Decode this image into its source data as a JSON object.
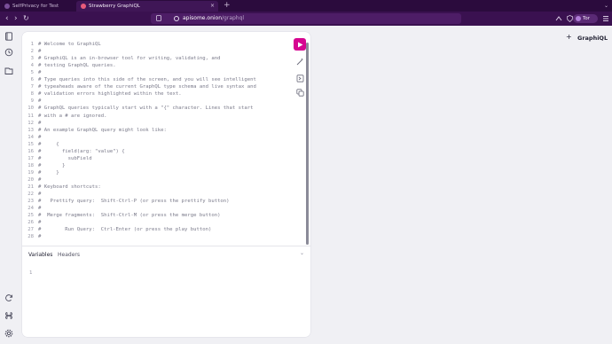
{
  "browser": {
    "tabs": [
      {
        "label": "SelfPrivacy for Test",
        "active": false
      },
      {
        "label": "Strawberry GraphiQL",
        "active": true
      }
    ],
    "close_glyph": "×",
    "new_tab_glyph": "+",
    "tab_list_glyph": "⌄",
    "nav": {
      "back": "‹",
      "forward": "›",
      "reload": "↻"
    },
    "url": {
      "host": "apisome.onion",
      "path": "/graphql"
    },
    "tor_label": "Tor"
  },
  "editor": {
    "lines": [
      {
        "n": "1",
        "t": "# Welcome to GraphiQL"
      },
      {
        "n": "2",
        "t": "#"
      },
      {
        "n": "3",
        "t": "# GraphiQL is an in-browser tool for writing, validating, and"
      },
      {
        "n": "4",
        "t": "# testing GraphQL queries."
      },
      {
        "n": "5",
        "t": "#"
      },
      {
        "n": "6",
        "t": "# Type queries into this side of the screen, and you will see intelligent"
      },
      {
        "n": "7",
        "t": "# typeaheads aware of the current GraphQL type schema and live syntax and"
      },
      {
        "n": "8",
        "t": "# validation errors highlighted within the text."
      },
      {
        "n": "9",
        "t": "#"
      },
      {
        "n": "10",
        "t": "# GraphQL queries typically start with a \"{\" character. Lines that start"
      },
      {
        "n": "11",
        "t": "# with a # are ignored."
      },
      {
        "n": "12",
        "t": "#"
      },
      {
        "n": "13",
        "t": "# An example GraphQL query might look like:"
      },
      {
        "n": "14",
        "t": "#"
      },
      {
        "n": "15",
        "t": "#     {"
      },
      {
        "n": "16",
        "t": "#       field(arg: \"value\") {"
      },
      {
        "n": "17",
        "t": "#         subField"
      },
      {
        "n": "18",
        "t": "#       }"
      },
      {
        "n": "19",
        "t": "#     }"
      },
      {
        "n": "20",
        "t": "#"
      },
      {
        "n": "21",
        "t": "# Keyboard shortcuts:"
      },
      {
        "n": "22",
        "t": "#"
      },
      {
        "n": "23",
        "t": "#   Prettify query:  Shift-Ctrl-P (or press the prettify button)"
      },
      {
        "n": "24",
        "t": "#"
      },
      {
        "n": "25",
        "t": "#  Merge fragments:  Shift-Ctrl-M (or press the merge button)"
      },
      {
        "n": "26",
        "t": "#"
      },
      {
        "n": "27",
        "t": "#        Run Query:  Ctrl-Enter (or press the play button)"
      },
      {
        "n": "28",
        "t": "#"
      }
    ],
    "variables_tab": "Variables",
    "headers_tab": "Headers",
    "variables_line_number": "1",
    "chevron_glyph": "⌄"
  },
  "result": {
    "title": "GraphiQL",
    "plus_glyph": "+"
  },
  "colors": {
    "accent": "#d60590",
    "tab_bar": "#2b0b3d",
    "nav_bar": "#3a1150"
  }
}
